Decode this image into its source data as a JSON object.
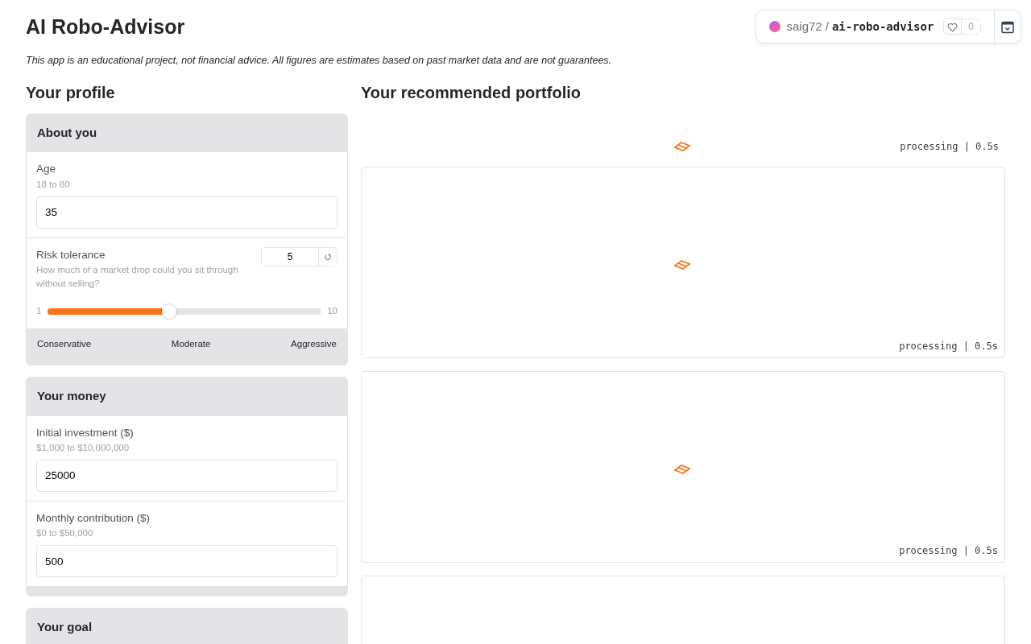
{
  "title": "AI Robo-Advisor",
  "disclaimer": "This app is an educational project, not financial advice. All figures are estimates based on past market data and are not guarantees.",
  "repo_badge": {
    "owner": "saig72",
    "separator": "/",
    "repo": "ai-robo-advisor",
    "likes": "0"
  },
  "profile": {
    "heading": "Your profile",
    "sections": [
      {
        "title": "About you",
        "fields": [
          {
            "kind": "number",
            "label": "Age",
            "hint": "18 to 80",
            "value": "35"
          },
          {
            "kind": "slider",
            "label": "Risk tolerance",
            "hint": "How much of a market drop could you sit through without selling?",
            "value": "5",
            "min": "1",
            "max": "10",
            "level": 0.444,
            "scale": [
              "Conservative",
              "Moderate",
              "Aggressive"
            ]
          }
        ]
      },
      {
        "title": "Your money",
        "fields": [
          {
            "kind": "number",
            "label": "Initial investment ($)",
            "hint": "$1,000 to $10,000,000",
            "value": "25000"
          },
          {
            "kind": "number",
            "label": "Monthly contribution ($)",
            "hint": "$0 to $50,000",
            "value": "500"
          }
        ]
      },
      {
        "title": "Your goal"
      }
    ]
  },
  "portfolio": {
    "heading": "Your recommended portfolio",
    "status": "processing | 0.5s",
    "panels": [
      {
        "kind": "loading",
        "status": "processing | 0.5s"
      },
      {
        "kind": "loading",
        "status": "processing | 0.5s"
      },
      {
        "kind": "empty"
      }
    ]
  }
}
